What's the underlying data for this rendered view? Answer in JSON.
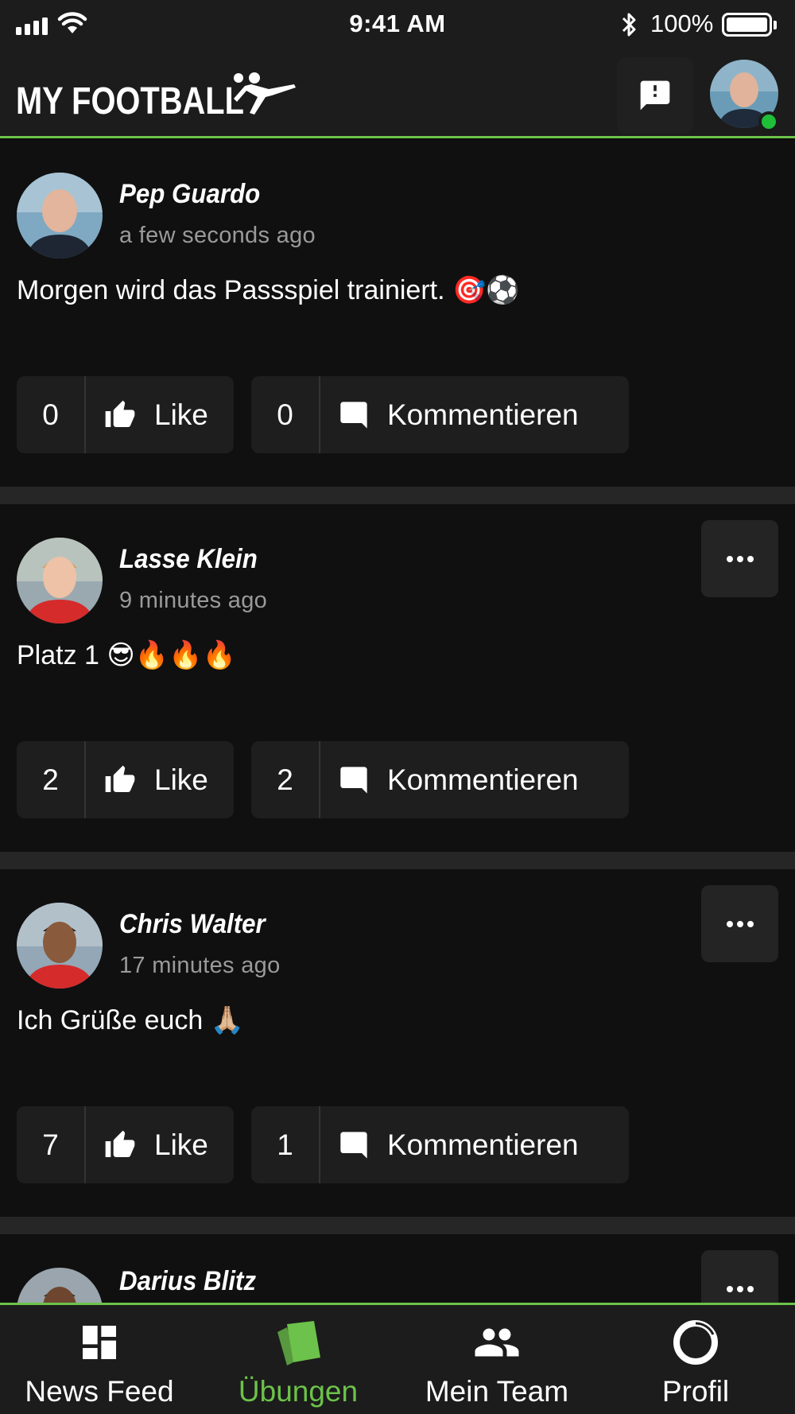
{
  "status_bar": {
    "time": "9:41 AM",
    "battery_percent": "100%",
    "icons": [
      "cellular-signal-icon",
      "wifi-icon",
      "bluetooth-icon",
      "battery-icon"
    ]
  },
  "header": {
    "logo_text": "MY FOOTBALL",
    "chat_icon": "chat-alert-icon",
    "accent_color": "#6cc24a",
    "online_color": "#1fbf3a"
  },
  "posts": [
    {
      "author": "Pep Guardo",
      "time": "a few seconds ago",
      "text": "Morgen wird das Passspiel trainiert. 🎯⚽",
      "likes": "0",
      "like_label": "Like",
      "comments": "0",
      "comment_label": "Kommentieren",
      "has_menu": false
    },
    {
      "author": "Lasse Klein",
      "time": "9 minutes ago",
      "text": "Platz 1 😎🔥🔥🔥",
      "likes": "2",
      "like_label": "Like",
      "comments": "2",
      "comment_label": "Kommentieren",
      "has_menu": true
    },
    {
      "author": "Chris Walter",
      "time": "17 minutes ago",
      "text": "Ich Grüße euch 🙏🏼",
      "likes": "7",
      "like_label": "Like",
      "comments": "1",
      "comment_label": "Kommentieren",
      "has_menu": true
    },
    {
      "author": "Darius Blitz",
      "has_menu": true
    }
  ],
  "bottom_nav": {
    "items": [
      {
        "label": "News Feed",
        "icon": "dashboard-icon",
        "active": false
      },
      {
        "label": "Übungen",
        "icon": "cards-icon",
        "active": true
      },
      {
        "label": "Mein Team",
        "icon": "team-icon",
        "active": false
      },
      {
        "label": "Profil",
        "icon": "profile-ring-icon",
        "active": false
      }
    ]
  }
}
